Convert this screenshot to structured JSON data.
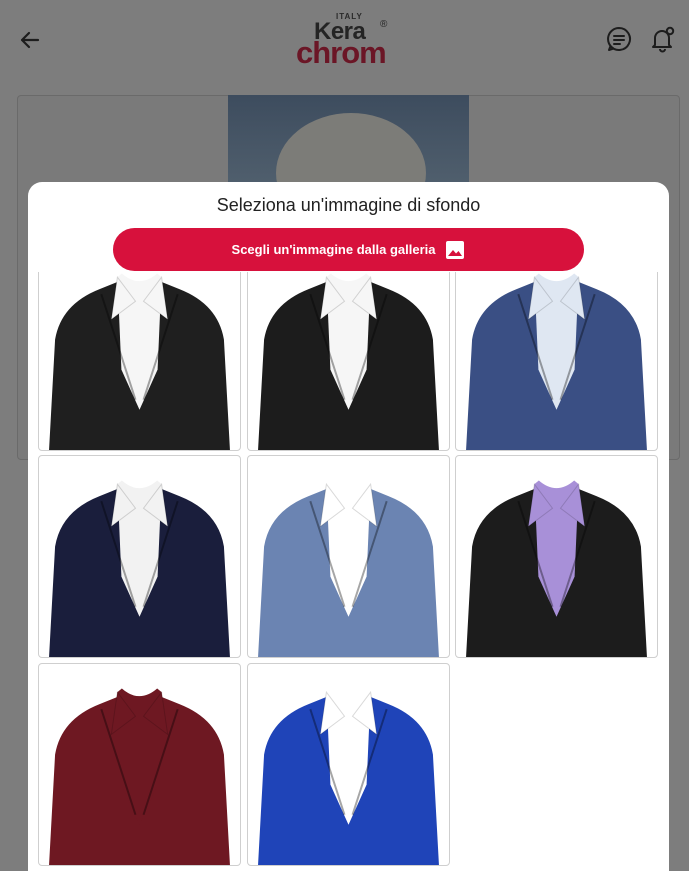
{
  "header": {
    "logo_small": "ITALY",
    "logo_word1": "Kera",
    "logo_word2": "chrom",
    "logo_reg": "®"
  },
  "modal": {
    "title": "Seleziona un'immagine di sfondo",
    "gallery_button_label": "Scegli un'immagine dalla galleria"
  },
  "backgrounds": [
    {
      "label": "black-blazer-white-shirt",
      "jacket": "#1f1f1f",
      "shirt": "#f6f6f6"
    },
    {
      "label": "black-blazer-white-shirt-2",
      "jacket": "#1c1c1c",
      "shirt": "#f6f6f6"
    },
    {
      "label": "blue-tweed-blazer-light-blue-shirt",
      "jacket": "#3a4f84",
      "shirt": "#dfe7f2"
    },
    {
      "label": "navy-striped-blouse-white-collar",
      "jacket": "#1a1e3c",
      "shirt": "#f2f2f2"
    },
    {
      "label": "blue-denim-vest-white-shirt",
      "jacket": "#6b84b2",
      "shirt": "#ffffff"
    },
    {
      "label": "black-blazer-lilac-blouse",
      "jacket": "#1c1c1c",
      "shirt": "#a890d8"
    },
    {
      "label": "burgundy-knit-cardigan",
      "jacket": "#6e1822",
      "shirt": "#6e1822"
    },
    {
      "label": "royal-blue-jacket-lace-collar",
      "jacket": "#1f44b8",
      "shirt": "#ffffff"
    }
  ],
  "colors": {
    "accent": "#d7113c",
    "overlay": "#7d7d7d",
    "modal_bg": "#ffffff"
  },
  "icons": {
    "back": "arrow-left-icon",
    "chat": "chat-bubble-icon",
    "bell": "bell-icon",
    "gallery": "image-icon"
  }
}
